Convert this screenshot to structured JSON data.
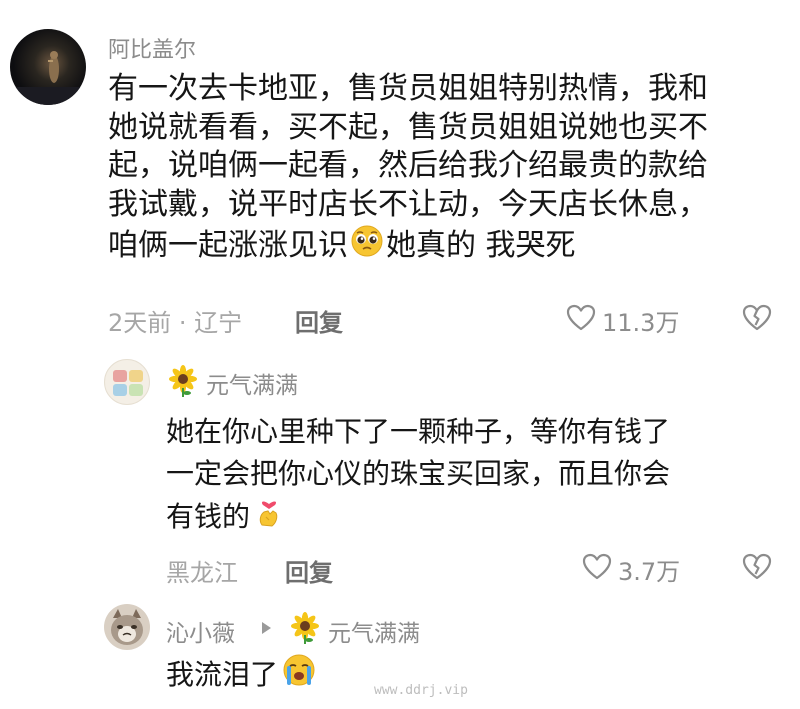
{
  "comments": [
    {
      "author": "阿比盖尔",
      "lines": [
        "有一次去卡地亚，售货员姐姐特别热情，我和",
        "她说就看看，买不起，售货员姐姐说她也买不",
        "起，说咱俩一起看，然后给我介绍最贵的款给",
        "我试戴，说平时店长不让动，今天店长休息，",
        "咱俩一起涨涨见识",
        "她真的 我哭死"
      ],
      "meta": "2天前 · 辽宁",
      "reply_label": "回复",
      "likes": "11.3万"
    },
    {
      "author": "元气满满",
      "lines": [
        "她在你心里种下了一颗种子，等你有钱了",
        "一定会把你心仪的珠宝买回家，而且你会",
        "有钱的"
      ],
      "meta": "黑龙江",
      "reply_label": "回复",
      "likes": "3.7万"
    },
    {
      "author": "沁小薇",
      "reply_to": "元气满满",
      "lines": [
        "我流泪了"
      ]
    }
  ],
  "watermark": "www.ddrj.vip",
  "icons": {
    "like": "heart-outline-icon",
    "dislike": "broken-heart-icon",
    "reply_arrow": "triangle-right-icon",
    "badge": "sunflower-icon"
  }
}
